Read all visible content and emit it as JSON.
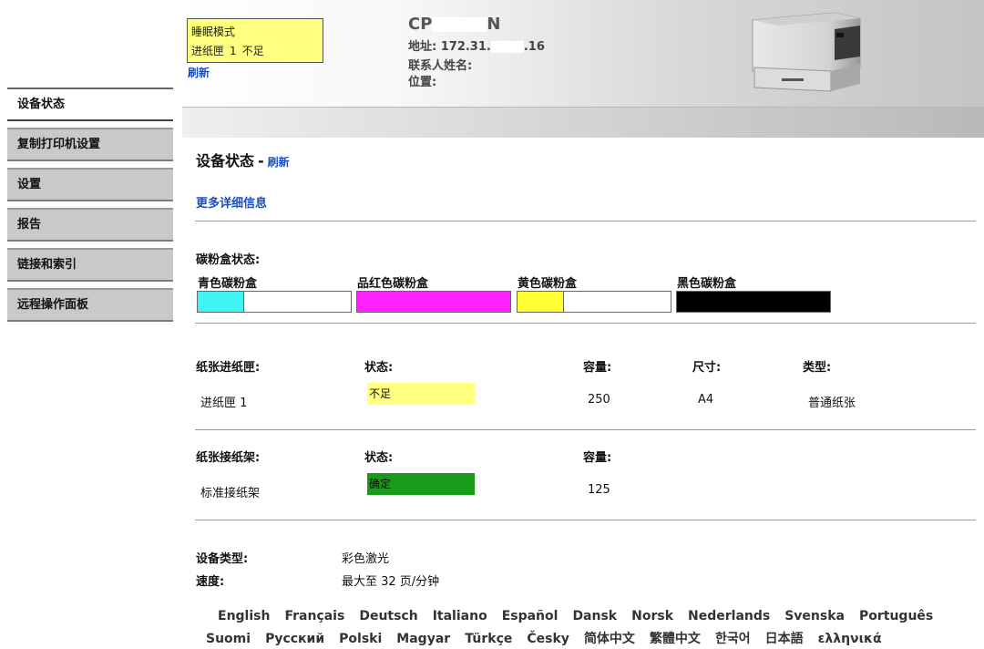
{
  "header": {
    "status_box": {
      "line1": "睡眠模式",
      "line2_tray": "进纸匣",
      "line2_num": "1",
      "line2_state": "不足",
      "bg_color": "#ffff80"
    },
    "refresh": "刷新",
    "model_prefix": "CP",
    "model_suffix": "N",
    "address_prefix": "地址: 172.31.",
    "address_suffix": ".16",
    "contact_label": "联系人姓名:",
    "location_label": "位置:"
  },
  "sidebar": {
    "items": [
      {
        "label": "设备状态",
        "active": true
      },
      {
        "label": "复制打印机设置",
        "active": false
      },
      {
        "label": "设置",
        "active": false
      },
      {
        "label": "报告",
        "active": false
      },
      {
        "label": "链接和索引",
        "active": false
      },
      {
        "label": "远程操作面板",
        "active": false
      }
    ]
  },
  "main": {
    "title": "设备状态",
    "title_dash": "-",
    "title_refresh": "刷新",
    "more_info": "更多详细信息",
    "toner": {
      "label": "碳粉盒状态:",
      "cartridges": [
        {
          "name": "青色碳粉盒",
          "color": "#40f4f4",
          "level": 0.3
        },
        {
          "name": "品红色碳粉盒",
          "color": "#ff22ff",
          "level": 1.0
        },
        {
          "name": "黄色碳粉盒",
          "color": "#ffff33",
          "level": 0.3
        },
        {
          "name": "黑色碳粉盒",
          "color": "#000000",
          "level": 1.0
        }
      ]
    },
    "input_tray": {
      "header_name": "纸张进纸匣:",
      "header_status": "状态:",
      "header_capacity": "容量:",
      "header_size": "尺寸:",
      "header_type": "类型:",
      "row_name": "进纸匣 1",
      "row_status": "不足",
      "row_status_color": "#ffff80",
      "row_capacity": "250",
      "row_size": "A4",
      "row_type": "普通纸张"
    },
    "output_bin": {
      "header_name": "纸张接纸架:",
      "header_status": "状态:",
      "header_capacity": "容量:",
      "row_name": "标准接纸架",
      "row_status": "确定",
      "row_status_color": "#1a9a1a",
      "row_capacity": "125"
    },
    "device": {
      "type_label": "设备类型:",
      "type_value": "彩色激光",
      "speed_label": "速度:",
      "speed_value": "最大至 32 页/分钟"
    },
    "languages": {
      "row1": [
        "English",
        "Français",
        "Deutsch",
        "Italiano",
        "Español",
        "Dansk",
        "Norsk",
        "Nederlands",
        "Svenska",
        "Português"
      ],
      "row2": [
        "Suomi",
        "Русский",
        "Polski",
        "Magyar",
        "Türkçe",
        "Česky",
        "简体中文",
        "繁體中文",
        "한국어",
        "日本語",
        "ελληνικά"
      ]
    }
  }
}
